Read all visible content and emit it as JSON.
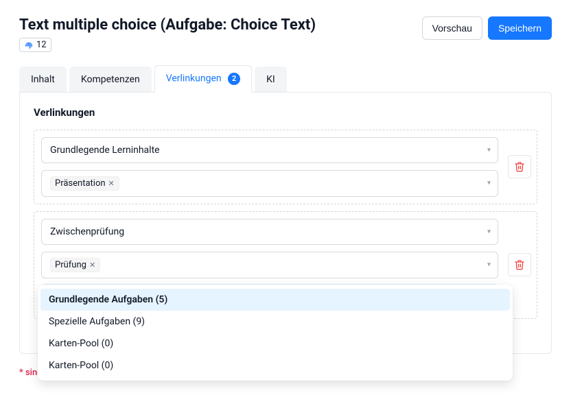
{
  "header": {
    "title": "Text multiple choice (Aufgabe: Choice Text)",
    "badge_value": "12",
    "preview": "Vorschau",
    "save": "Speichern"
  },
  "tabs": [
    {
      "label": "Inhalt",
      "active": false,
      "badge": null
    },
    {
      "label": "Kompetenzen",
      "active": false,
      "badge": null
    },
    {
      "label": "Verlinkungen",
      "active": true,
      "badge": "2"
    },
    {
      "label": "KI",
      "active": false,
      "badge": null
    }
  ],
  "section_title": "Verlinkungen",
  "groups": [
    {
      "select_value": "Grundlegende Lerninhalte",
      "tags": [
        "Präsentation"
      ]
    },
    {
      "select_value": "Zwischenprüfung",
      "tags": [
        "Prüfung"
      ]
    }
  ],
  "open_select_placeholder": "Grundlegende Aufgaben (5)",
  "options": [
    "Grundlegende Aufgaben (5)",
    "Spezielle Aufgaben (9)",
    "Karten-Pool (0)",
    "Karten-Pool (0)"
  ],
  "footer_partial": "* sind"
}
